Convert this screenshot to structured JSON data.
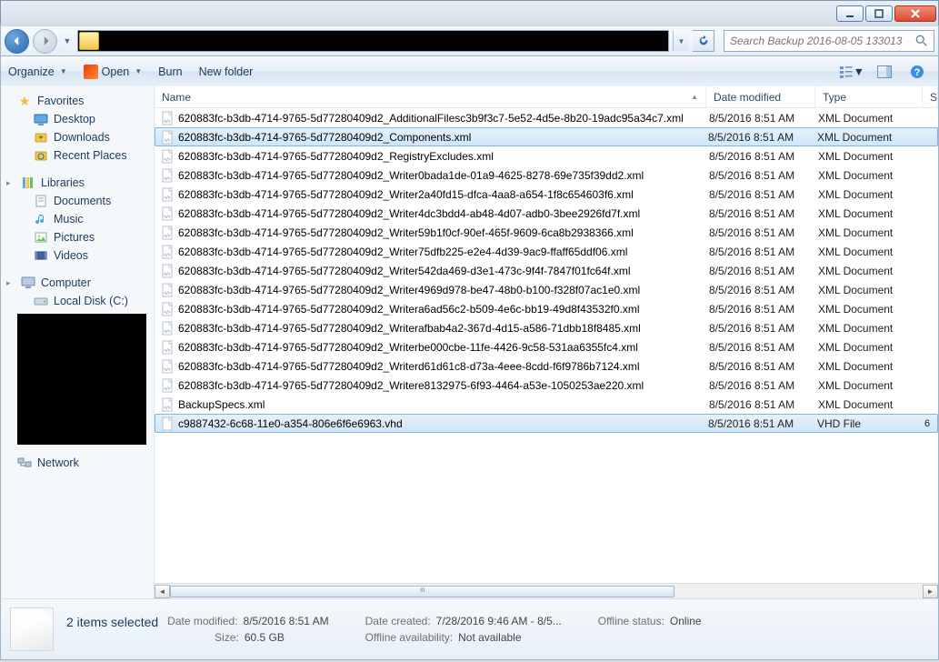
{
  "search": {
    "placeholder": "Search Backup 2016-08-05 133013"
  },
  "toolbar": {
    "organize": "Organize",
    "open": "Open",
    "burn": "Burn",
    "newfolder": "New folder"
  },
  "sidebar": {
    "favorites": "Favorites",
    "desktop": "Desktop",
    "downloads": "Downloads",
    "recent": "Recent Places",
    "libraries": "Libraries",
    "documents": "Documents",
    "music": "Music",
    "pictures": "Pictures",
    "videos": "Videos",
    "computer": "Computer",
    "localdisk": "Local Disk (C:)",
    "network": "Network"
  },
  "columns": {
    "name": "Name",
    "date": "Date modified",
    "type": "Type",
    "size": "S"
  },
  "files": [
    {
      "sel": false,
      "kind": "xml",
      "name": "620883fc-b3db-4714-9765-5d77280409d2_AdditionalFilesc3b9f3c7-5e52-4d5e-8b20-19adc95a34c7.xml",
      "date": "8/5/2016 8:51 AM",
      "type": "XML Document",
      "size": ""
    },
    {
      "sel": true,
      "kind": "xml",
      "name": "620883fc-b3db-4714-9765-5d77280409d2_Components.xml",
      "date": "8/5/2016 8:51 AM",
      "type": "XML Document",
      "size": ""
    },
    {
      "sel": false,
      "kind": "xml",
      "name": "620883fc-b3db-4714-9765-5d77280409d2_RegistryExcludes.xml",
      "date": "8/5/2016 8:51 AM",
      "type": "XML Document",
      "size": ""
    },
    {
      "sel": false,
      "kind": "xml",
      "name": "620883fc-b3db-4714-9765-5d77280409d2_Writer0bada1de-01a9-4625-8278-69e735f39dd2.xml",
      "date": "8/5/2016 8:51 AM",
      "type": "XML Document",
      "size": ""
    },
    {
      "sel": false,
      "kind": "xml",
      "name": "620883fc-b3db-4714-9765-5d77280409d2_Writer2a40fd15-dfca-4aa8-a654-1f8c654603f6.xml",
      "date": "8/5/2016 8:51 AM",
      "type": "XML Document",
      "size": ""
    },
    {
      "sel": false,
      "kind": "xml",
      "name": "620883fc-b3db-4714-9765-5d77280409d2_Writer4dc3bdd4-ab48-4d07-adb0-3bee2926fd7f.xml",
      "date": "8/5/2016 8:51 AM",
      "type": "XML Document",
      "size": ""
    },
    {
      "sel": false,
      "kind": "xml",
      "name": "620883fc-b3db-4714-9765-5d77280409d2_Writer59b1f0cf-90ef-465f-9609-6ca8b2938366.xml",
      "date": "8/5/2016 8:51 AM",
      "type": "XML Document",
      "size": ""
    },
    {
      "sel": false,
      "kind": "xml",
      "name": "620883fc-b3db-4714-9765-5d77280409d2_Writer75dfb225-e2e4-4d39-9ac9-ffaff65ddf06.xml",
      "date": "8/5/2016 8:51 AM",
      "type": "XML Document",
      "size": ""
    },
    {
      "sel": false,
      "kind": "xml",
      "name": "620883fc-b3db-4714-9765-5d77280409d2_Writer542da469-d3e1-473c-9f4f-7847f01fc64f.xml",
      "date": "8/5/2016 8:51 AM",
      "type": "XML Document",
      "size": ""
    },
    {
      "sel": false,
      "kind": "xml",
      "name": "620883fc-b3db-4714-9765-5d77280409d2_Writer4969d978-be47-48b0-b100-f328f07ac1e0.xml",
      "date": "8/5/2016 8:51 AM",
      "type": "XML Document",
      "size": ""
    },
    {
      "sel": false,
      "kind": "xml",
      "name": "620883fc-b3db-4714-9765-5d77280409d2_Writera6ad56c2-b509-4e6c-bb19-49d8f43532f0.xml",
      "date": "8/5/2016 8:51 AM",
      "type": "XML Document",
      "size": ""
    },
    {
      "sel": false,
      "kind": "xml",
      "name": "620883fc-b3db-4714-9765-5d77280409d2_Writerafbab4a2-367d-4d15-a586-71dbb18f8485.xml",
      "date": "8/5/2016 8:51 AM",
      "type": "XML Document",
      "size": ""
    },
    {
      "sel": false,
      "kind": "xml",
      "name": "620883fc-b3db-4714-9765-5d77280409d2_Writerbe000cbe-11fe-4426-9c58-531aa6355fc4.xml",
      "date": "8/5/2016 8:51 AM",
      "type": "XML Document",
      "size": ""
    },
    {
      "sel": false,
      "kind": "xml",
      "name": "620883fc-b3db-4714-9765-5d77280409d2_Writerd61d61c8-d73a-4eee-8cdd-f6f9786b7124.xml",
      "date": "8/5/2016 8:51 AM",
      "type": "XML Document",
      "size": ""
    },
    {
      "sel": false,
      "kind": "xml",
      "name": "620883fc-b3db-4714-9765-5d77280409d2_Writere8132975-6f93-4464-a53e-1050253ae220.xml",
      "date": "8/5/2016 8:51 AM",
      "type": "XML Document",
      "size": ""
    },
    {
      "sel": false,
      "kind": "xml",
      "name": "BackupSpecs.xml",
      "date": "8/5/2016 8:51 AM",
      "type": "XML Document",
      "size": ""
    },
    {
      "sel": true,
      "kind": "vhd",
      "name": "c9887432-6c68-11e0-a354-806e6f6e6963.vhd",
      "date": "8/5/2016 8:51 AM",
      "type": "VHD File",
      "size": "6"
    }
  ],
  "details": {
    "title": "2 items selected",
    "dm_label": "Date modified:",
    "dm_value": "8/5/2016 8:51 AM",
    "size_label": "Size:",
    "size_value": "60.5 GB",
    "dc_label": "Date created:",
    "dc_value": "7/28/2016 9:46 AM - 8/5...",
    "oa_label": "Offline availability:",
    "oa_value": "Not available",
    "os_label": "Offline status:",
    "os_value": "Online"
  }
}
